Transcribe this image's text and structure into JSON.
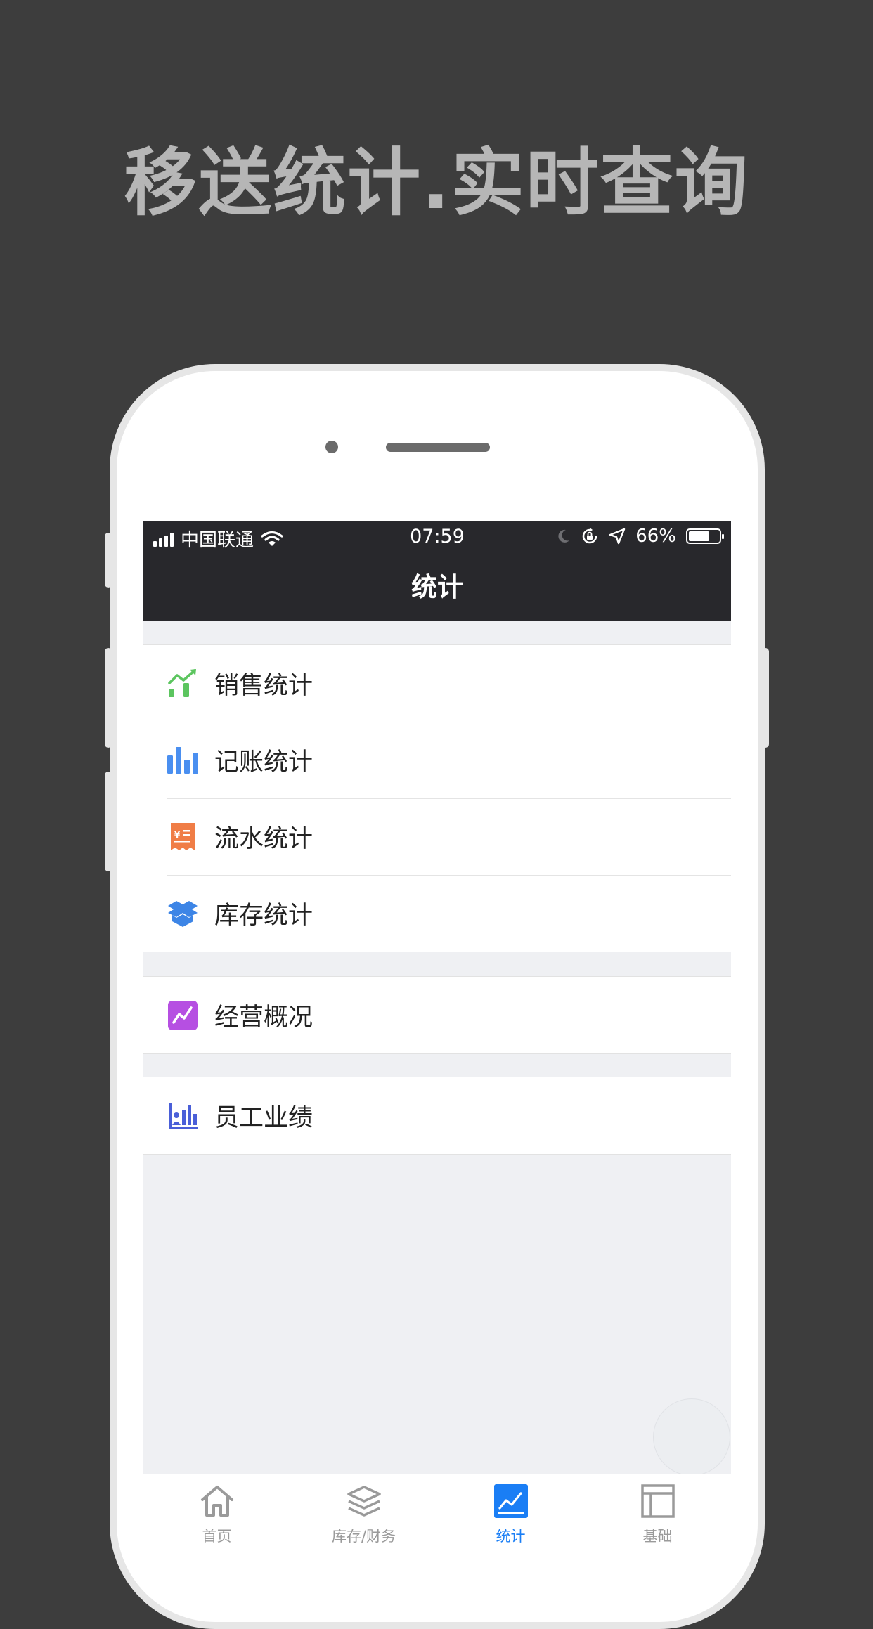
{
  "headline": "移送统计.实时查询",
  "status": {
    "carrier": "中国联通",
    "time": "07:59",
    "battery": "66%"
  },
  "nav": {
    "title": "统计"
  },
  "menu_groups": [
    {
      "items": [
        {
          "label": "销售统计",
          "icon": "sales-trend-icon",
          "color": "#5cc55f"
        },
        {
          "label": "记账统计",
          "icon": "bar-chart-icon",
          "color": "#4a8ff0"
        },
        {
          "label": "流水统计",
          "icon": "receipt-icon",
          "color": "#f07d46"
        },
        {
          "label": "库存统计",
          "icon": "box-icon",
          "color": "#3d85e6"
        }
      ]
    },
    {
      "items": [
        {
          "label": "经营概况",
          "icon": "line-chart-icon",
          "color": "#b64fe2"
        }
      ]
    },
    {
      "items": [
        {
          "label": "员工业绩",
          "icon": "staff-chart-icon",
          "color": "#4a5fd8"
        }
      ]
    }
  ],
  "tabs": [
    {
      "label": "首页",
      "icon": "home-icon",
      "active": false
    },
    {
      "label": "库存/财务",
      "icon": "layers-icon",
      "active": false
    },
    {
      "label": "统计",
      "icon": "chart-icon",
      "active": true
    },
    {
      "label": "基础",
      "icon": "layout-icon",
      "active": false
    }
  ],
  "colors": {
    "accent": "#1a7ef5",
    "header": "#28282c",
    "background": "#eff0f3"
  }
}
